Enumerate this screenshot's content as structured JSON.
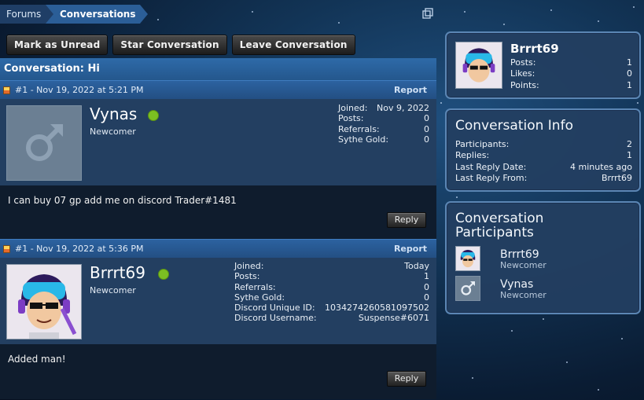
{
  "breadcrumb": [
    "Forums",
    "Conversations"
  ],
  "actions": {
    "mark_unread": "Mark as Unread",
    "star": "Star Conversation",
    "leave": "Leave Conversation"
  },
  "conversation": {
    "title": "Conversation: Hi"
  },
  "messages": [
    {
      "meta": "#1 - Nov 19, 2022 at 5:21 PM",
      "report": "Report",
      "username": "Vynas",
      "user_title": "Newcomer",
      "avatar": "male-symbol-icon",
      "stats": [
        {
          "label": "Joined:",
          "value": "Nov 9, 2022"
        },
        {
          "label": "Posts:",
          "value": "0"
        },
        {
          "label": "Referrals:",
          "value": "0"
        },
        {
          "label": "Sythe Gold:",
          "value": "0"
        }
      ],
      "body": "I can buy 07 gp add me on discord Trader#1481",
      "reply": "Reply"
    },
    {
      "meta": "#1 - Nov 19, 2022 at 5:36 PM",
      "report": "Report",
      "username": "Brrrt69",
      "user_title": "Newcomer",
      "avatar": "cartoon-avatar-icon",
      "stats": [
        {
          "label": "Joined:",
          "value": "Today"
        },
        {
          "label": "Posts:",
          "value": "1"
        },
        {
          "label": "Referrals:",
          "value": "0"
        },
        {
          "label": "Sythe Gold:",
          "value": "0"
        },
        {
          "label": "Discord Unique ID:",
          "value": "1034274260581097502"
        },
        {
          "label": "Discord Username:",
          "value": "Suspense#6071"
        }
      ],
      "body": "Added man!",
      "reply": "Reply"
    }
  ],
  "sidebar": {
    "profile": {
      "name": "Brrrt69",
      "stats": [
        {
          "label": "Posts:",
          "value": "1"
        },
        {
          "label": "Likes:",
          "value": "0"
        },
        {
          "label": "Points:",
          "value": "1"
        }
      ]
    },
    "info": {
      "title": "Conversation Info",
      "rows": [
        {
          "label": "Participants:",
          "value": "2"
        },
        {
          "label": "Replies:",
          "value": "1"
        },
        {
          "label": "Last Reply Date:",
          "value": "4 minutes ago"
        },
        {
          "label": "Last Reply From:",
          "value": "Brrrt69"
        }
      ]
    },
    "participants": {
      "title_line1": "Conversation",
      "title_line2": "Participants",
      "list": [
        {
          "name": "Brrrt69",
          "role": "Newcomer"
        },
        {
          "name": "Vynas",
          "role": "Newcomer"
        }
      ]
    }
  },
  "colors": {
    "accent": "#2b5e97",
    "online": "#7bbf22",
    "panel_border": "#5b86b4"
  }
}
